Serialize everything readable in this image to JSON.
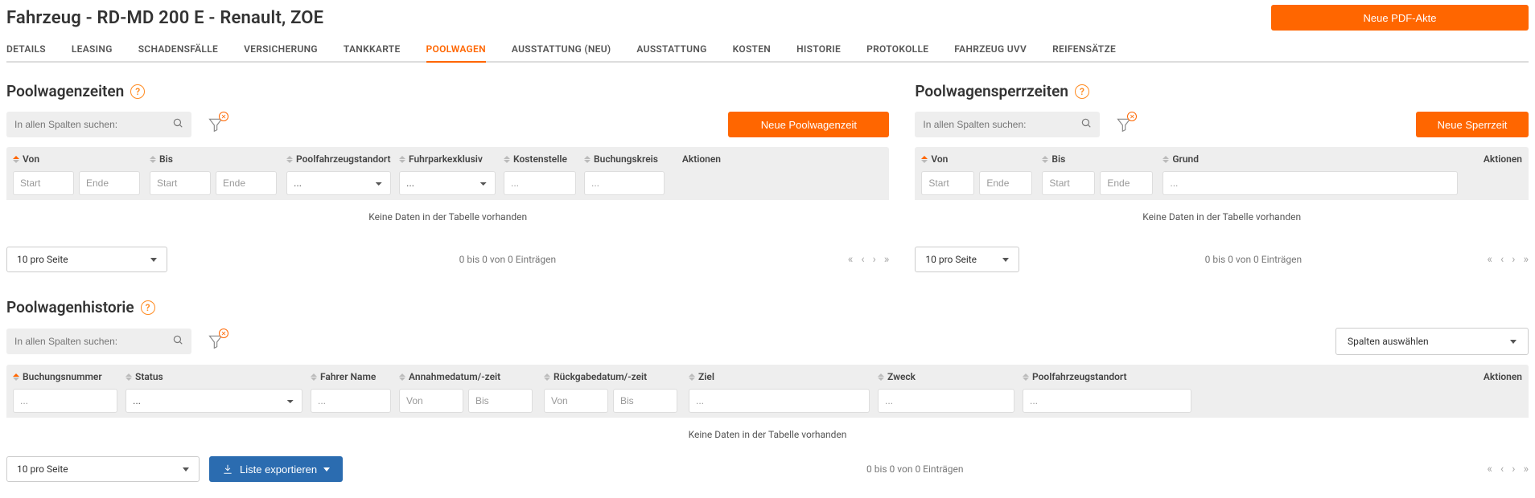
{
  "header": {
    "title": "Fahrzeug - RD-MD 200 E - Renault, ZOE",
    "new_pdf_label": "Neue PDF-Akte"
  },
  "tabs": [
    {
      "label": "DETAILS",
      "active": false
    },
    {
      "label": "LEASING",
      "active": false
    },
    {
      "label": "SCHADENSFÄLLE",
      "active": false
    },
    {
      "label": "VERSICHERUNG",
      "active": false
    },
    {
      "label": "TANKKARTE",
      "active": false
    },
    {
      "label": "POOLWAGEN",
      "active": true
    },
    {
      "label": "AUSSTATTUNG (NEU)",
      "active": false
    },
    {
      "label": "AUSSTATTUNG",
      "active": false
    },
    {
      "label": "KOSTEN",
      "active": false
    },
    {
      "label": "HISTORIE",
      "active": false
    },
    {
      "label": "PROTOKOLLE",
      "active": false
    },
    {
      "label": "FAHRZEUG UVV",
      "active": false
    },
    {
      "label": "REIFENSÄTZE",
      "active": false
    }
  ],
  "common": {
    "search_placeholder": "In allen Spalten suchen:",
    "start": "Start",
    "ende": "Ende",
    "von": "Von",
    "bis": "Bis",
    "dots": "...",
    "no_data": "Keine Daten in der Tabelle vorhanden",
    "page_size": "10 pro Seite",
    "entries_info": "0 bis 0 von 0 Einträgen",
    "aktionen": "Aktionen"
  },
  "poolwagenzeiten": {
    "title": "Poolwagenzeiten",
    "new_btn": "Neue Poolwagenzeit",
    "cols": {
      "von": "Von",
      "bis": "Bis",
      "standort": "Poolfahrzeugstandort",
      "fuhrpark": "Fuhrparkexklusiv",
      "kostenstelle": "Kostenstelle",
      "buchungskreis": "Buchungskreis"
    }
  },
  "sperrzeiten": {
    "title": "Poolwagensperrzeiten",
    "new_btn": "Neue Sperrzeit",
    "cols": {
      "von": "Von",
      "bis": "Bis",
      "grund": "Grund"
    }
  },
  "historie": {
    "title": "Poolwagenhistorie",
    "columns_btn": "Spalten auswählen",
    "export_btn": "Liste exportieren",
    "cols": {
      "buchungsnr": "Buchungsnummer",
      "status": "Status",
      "fahrer": "Fahrer Name",
      "annahme": "Annahmedatum/-zeit",
      "rueckgabe": "Rückgabedatum/-zeit",
      "ziel": "Ziel",
      "zweck": "Zweck",
      "standort": "Poolfahrzeugstandort"
    }
  }
}
